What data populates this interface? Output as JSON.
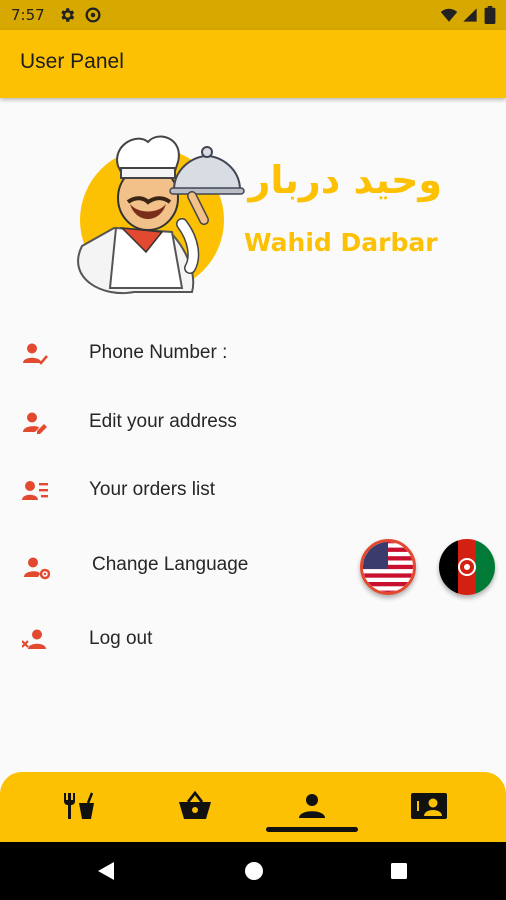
{
  "status_bar": {
    "time": "7:57"
  },
  "app_bar": {
    "title": "User Panel"
  },
  "logo": {
    "arabic_text": "وحید دربار",
    "latin_text": "Wahid Darbar"
  },
  "menu": [
    {
      "label": "Phone Number :",
      "icon": "person-check-icon"
    },
    {
      "label": "Edit your address",
      "icon": "person-edit-icon"
    },
    {
      "label": "Your orders list",
      "icon": "person-list-icon"
    },
    {
      "label": "Change Language",
      "icon": "person-settings-icon"
    },
    {
      "label": "Log out",
      "icon": "person-remove-icon"
    }
  ],
  "languages": [
    {
      "flag": "us-flag-icon"
    },
    {
      "flag": "afghanistan-flag-icon"
    }
  ],
  "bottom_nav": {
    "items": [
      "food-icon",
      "basket-icon",
      "person-icon",
      "contact-card-icon"
    ],
    "active": "person-icon"
  },
  "colors": {
    "accent": "#fbc102",
    "icon_red": "#e2492f",
    "status_bar": "#d7a800"
  }
}
